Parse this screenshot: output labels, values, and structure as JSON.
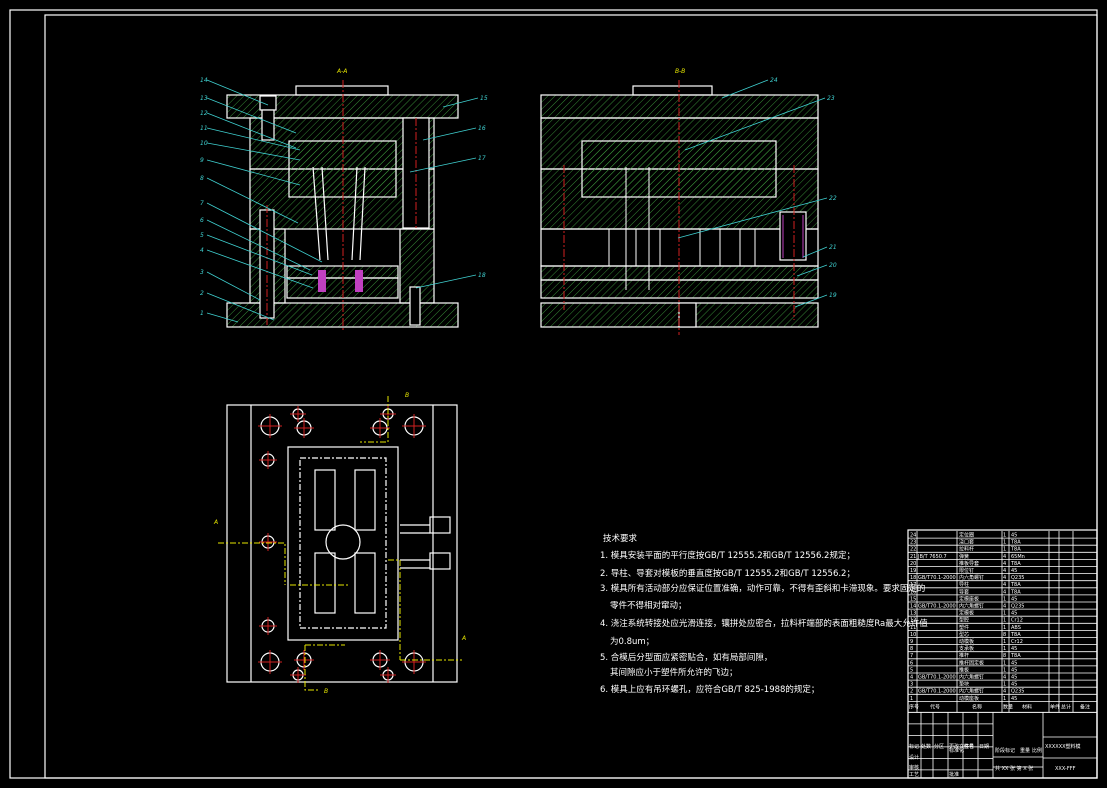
{
  "views": {
    "section_a": "A-A",
    "section_b": "B-B",
    "plan_markers": [
      "A",
      "A",
      "B",
      "B"
    ]
  },
  "callouts_left_view": [
    "14",
    "13",
    "12",
    "11",
    "10",
    "9",
    "8",
    "7",
    "6",
    "5",
    "4",
    "3",
    "2",
    "1"
  ],
  "callouts_left_view_right": [
    "15",
    "16",
    "17",
    "18"
  ],
  "callouts_right_view": [
    "24",
    "23",
    "22",
    "21",
    "20",
    "19"
  ],
  "technical_requirements": {
    "title": "技术要求",
    "lines": [
      "1. 模具安装平面的平行度按GB/T 12555.2和GB/T 12556.2规定；",
      "2. 导柱、导套对模板的垂直度按GB/T 12555.2和GB/T 12556.2；",
      "3. 模具所有活动部分应保证位置准确，动作可靠，不得有歪斜和卡滞现象。要求固定的",
      "零件不得相对窜动；",
      "4. 浇注系统转接处应光滑连接，镶拼处应密合，拉料杆端部的表面粗糙度Ra最大允许值",
      "为0.8um；",
      "5. 合模后分型面应紧密贴合，如有局部间隙，",
      "其间隙应小于塑件所允许的飞边；",
      "6. 模具上应有吊环螺孔，应符合GB/T 825-1988的规定；"
    ]
  },
  "bom": {
    "rows": [
      {
        "no": "24",
        "code": "",
        "name": "定位圈",
        "qty": "1",
        "material": "45"
      },
      {
        "no": "23",
        "code": "",
        "name": "浇口套",
        "qty": "1",
        "material": "T8A"
      },
      {
        "no": "22",
        "code": "",
        "name": "拉料杆",
        "qty": "1",
        "material": "T8A"
      },
      {
        "no": "21",
        "code": "JB/T 7650.7",
        "name": "弹簧",
        "qty": "4",
        "material": "65Mn"
      },
      {
        "no": "20",
        "code": "",
        "name": "推板导套",
        "qty": "4",
        "material": "T8A"
      },
      {
        "no": "19",
        "code": "",
        "name": "限位钉",
        "qty": "4",
        "material": "45"
      },
      {
        "no": "18",
        "code": "GB/T70.1-2000",
        "name": "内六角螺钉",
        "qty": "4",
        "material": "Q235"
      },
      {
        "no": "17",
        "code": "",
        "name": "导柱",
        "qty": "4",
        "material": "T8A"
      },
      {
        "no": "16",
        "code": "",
        "name": "导套",
        "qty": "4",
        "material": "T8A"
      },
      {
        "no": "15",
        "code": "",
        "name": "定模座板",
        "qty": "1",
        "material": "45"
      },
      {
        "no": "14",
        "code": "GB/T70.1-2000",
        "name": "内六角螺钉",
        "qty": "4",
        "material": "Q235"
      },
      {
        "no": "13",
        "code": "",
        "name": "定模板",
        "qty": "1",
        "material": "45"
      },
      {
        "no": "12",
        "code": "",
        "name": "型腔",
        "qty": "1",
        "material": "Cr12"
      },
      {
        "no": "11",
        "code": "",
        "name": "塑件",
        "qty": "1",
        "material": "ABS"
      },
      {
        "no": "10",
        "code": "",
        "name": "型芯",
        "qty": "8",
        "material": "T8A"
      },
      {
        "no": "9",
        "code": "",
        "name": "动模板",
        "qty": "1",
        "material": "Cr12"
      },
      {
        "no": "8",
        "code": "",
        "name": "支承板",
        "qty": "1",
        "material": "45"
      },
      {
        "no": "7",
        "code": "",
        "name": "推杆",
        "qty": "8",
        "material": "T8A"
      },
      {
        "no": "6",
        "code": "",
        "name": "推杆固定板",
        "qty": "1",
        "material": "45"
      },
      {
        "no": "5",
        "code": "",
        "name": "推板",
        "qty": "1",
        "material": "45"
      },
      {
        "no": "4",
        "code": "GB/T70.1-2000",
        "name": "内六角螺钉",
        "qty": "4",
        "material": "45"
      },
      {
        "no": "3",
        "code": "",
        "name": "垫块",
        "qty": "1",
        "material": "45"
      },
      {
        "no": "2",
        "code": "GB/T70.1-2000",
        "name": "内六角螺钉",
        "qty": "4",
        "material": "Q235"
      },
      {
        "no": "1",
        "code": "",
        "name": "动模座板",
        "qty": "1",
        "material": "45"
      }
    ],
    "header": {
      "no": "序号",
      "code": "代号",
      "name": "名称",
      "qty": "数量",
      "material": "材料",
      "unit": "单件",
      "total": "总计",
      "weight": "重量",
      "remark": "备注"
    }
  },
  "title_block": {
    "drawing_name": "XXXXXX塑料模",
    "drawing_number": "XXX-FFF",
    "sheets": "共 XX 张 第 X 张",
    "labels": [
      "标记",
      "处数",
      "分区",
      "更改文件号",
      "签名",
      "日期",
      "设计",
      "标准化",
      "审核",
      "工艺",
      "批准",
      "阶段标记",
      "重量",
      "比例"
    ]
  },
  "colors": {
    "background": "#000000",
    "outline": "#ffffff",
    "hatch": "#3c9a3c",
    "centerline": "#d02020",
    "leader": "#3fd0d0",
    "section_label": "#e6e600"
  }
}
